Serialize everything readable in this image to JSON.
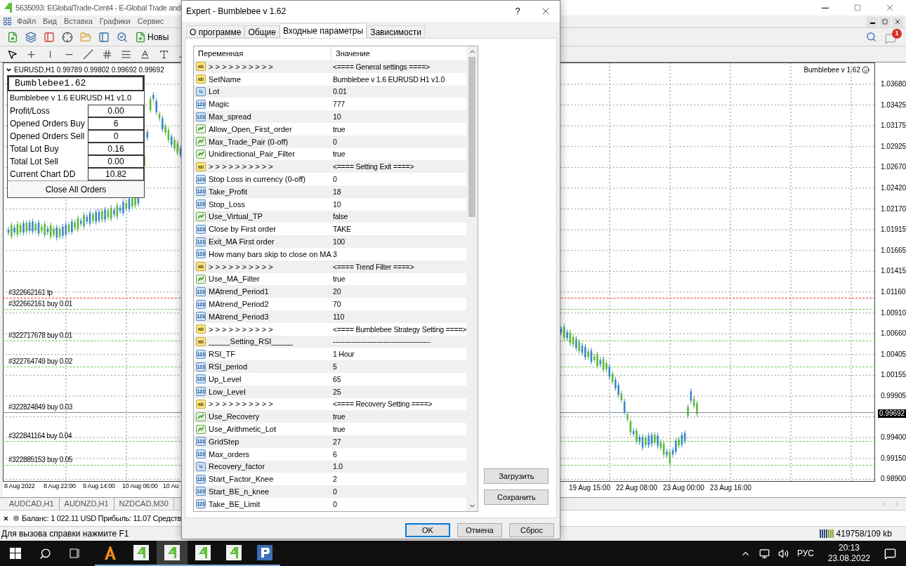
{
  "main_window": {
    "title": "5635093: EGlobalTrade-Cent4 - E-Global Trade and"
  },
  "menu": [
    "Файл",
    "Вид",
    "Вставка",
    "Графики",
    "Сервис"
  ],
  "toolbar": {
    "new_order_label": "Новы"
  },
  "notifications": {
    "count": "1"
  },
  "chart": {
    "symbol": "EURUSD,H1",
    "quotes": "0.99789 0.99802 0.99692 0.99692",
    "expert_label": "Bumblebee v 1.62",
    "order_lines": [
      {
        "label": "#322662161 tp",
        "kind": "tp"
      },
      {
        "label": "#322662161 buy 0.01",
        "kind": "buy"
      },
      {
        "label": "#322717678 buy 0.01",
        "kind": "buy"
      },
      {
        "label": "#322764749 buy 0.02",
        "kind": "buy"
      },
      {
        "label": "#322824849 buy 0.03",
        "kind": "price"
      },
      {
        "label": "#322841164 buy 0.04",
        "kind": "buy"
      },
      {
        "label": "#322885153 buy 0.05",
        "kind": "buy"
      }
    ],
    "price_labels": [
      "1.03680",
      "1.03425",
      "1.03175",
      "1.02925",
      "1.02670",
      "1.02420",
      "1.02170",
      "1.01915",
      "1.01665",
      "1.01415",
      "1.01160",
      "1.00910",
      "1.00660",
      "1.00405",
      "1.00155",
      "0.99905",
      "0.99400",
      "0.99150",
      "0.98900"
    ],
    "current_price": "0.99692",
    "time_labels_left": [
      "8 Aug 2022",
      "8 Aug 22:00",
      "9 Aug 14:00",
      "10 Aug 06:00",
      "10 Au"
    ],
    "time_labels_right": [
      "19 Aug 15:00",
      "22 Aug 08:00",
      "23 Aug 00:00",
      "23 Aug 16:00"
    ]
  },
  "info_panel": {
    "title": "Bumblebee1.62",
    "subtitle": "Bumblebee v 1.6 EURUSD H1 v1.0",
    "rows": [
      {
        "label": "Profit/Loss",
        "value": "0.00"
      },
      {
        "label": "Opened Orders Buy",
        "value": "6"
      },
      {
        "label": "Opened Orders Sell",
        "value": "0"
      },
      {
        "label": "Total Lot Buy",
        "value": "0.16"
      },
      {
        "label": "Total Lot Sell",
        "value": "0.00"
      },
      {
        "label": "Current Chart DD",
        "value": "10.82"
      }
    ],
    "button": "Close All Orders"
  },
  "chart_tabs": [
    {
      "label": "AUDCAD,H1",
      "selected": false
    },
    {
      "label": "AUDNZD,H1",
      "selected": false
    },
    {
      "label": "NZDCAD,M30",
      "selected": false
    }
  ],
  "terminal": {
    "summary": "Баланс: 1 022.11 USD Прибыль: 11.07 Средств"
  },
  "status_bar": {
    "help": "Для вызова справки нажмите F1",
    "traffic": "419758/109 kb"
  },
  "dialog": {
    "title": "Expert - Bumblebee v 1.62",
    "help": "?",
    "tabs": [
      {
        "label": "О программе",
        "selected": false
      },
      {
        "label": "Общие",
        "selected": false
      },
      {
        "label": "Входные параметры",
        "selected": true
      },
      {
        "label": "Зависимости",
        "selected": false
      }
    ],
    "columns": [
      "Переменная",
      "Значение"
    ],
    "rows": [
      {
        "kind": "string",
        "tag": "ab",
        "name": "> > > > > > > > > >",
        "value": "<==== General settings ====>"
      },
      {
        "kind": "string",
        "tag": "ab",
        "name": "SetName",
        "value": "Bumblebee v 1.6 EURUSD H1 v1.0"
      },
      {
        "kind": "double",
        "tag": "½",
        "name": "Lot",
        "value": "0.01"
      },
      {
        "kind": "int",
        "tag": "123",
        "name": "Magic",
        "value": "777"
      },
      {
        "kind": "int",
        "tag": "123",
        "name": "Max_spread",
        "value": "10"
      },
      {
        "kind": "bool",
        "name": "Allow_Open_First_order",
        "value": "true"
      },
      {
        "kind": "bool",
        "name": "Max_Trade_Pair (0-off)",
        "value": "0"
      },
      {
        "kind": "bool",
        "name": "Unidirectional_Pair_Filter",
        "value": "true"
      },
      {
        "kind": "string",
        "tag": "ab",
        "name": "> > > > > > > > > >",
        "value": "<==== Setting Exit ====>"
      },
      {
        "kind": "int",
        "tag": "123",
        "name": "Stop Loss in currency (0-off)",
        "value": "0"
      },
      {
        "kind": "int",
        "tag": "123",
        "name": "Take_Profit",
        "value": "18"
      },
      {
        "kind": "int",
        "tag": "123",
        "name": "Stop_Loss",
        "value": "10"
      },
      {
        "kind": "bool",
        "name": "Use_Virtual_TP",
        "value": "false"
      },
      {
        "kind": "int",
        "tag": "123",
        "name": "Close by First order",
        "value": "TAKE"
      },
      {
        "kind": "int",
        "tag": "123",
        "name": "Exit_MA First order",
        "value": "100"
      },
      {
        "kind": "int",
        "tag": "123",
        "name": "How many bars skip to close on MA",
        "value": "3"
      },
      {
        "kind": "string",
        "tag": "ab",
        "name": "> > > > > > > > > >",
        "value": "<==== Trend Filter ====>"
      },
      {
        "kind": "bool",
        "name": "Use_MA_Filter",
        "value": "true"
      },
      {
        "kind": "int",
        "tag": "123",
        "name": "MAtrend_Period1",
        "value": "20"
      },
      {
        "kind": "int",
        "tag": "123",
        "name": "MAtrend_Period2",
        "value": "70"
      },
      {
        "kind": "int",
        "tag": "123",
        "name": "MAtrend_Period3",
        "value": "110"
      },
      {
        "kind": "string",
        "tag": "ab",
        "name": "> > > > > > > > > >",
        "value": "<==== Bumblebee Strategy Setting ====>"
      },
      {
        "kind": "string",
        "tag": "ab",
        "name": "_____Setting_RSI_____",
        "value": "------------------------------------------"
      },
      {
        "kind": "int",
        "tag": "123",
        "name": "RSI_TF",
        "value": "1 Hour"
      },
      {
        "kind": "int",
        "tag": "123",
        "name": "RSI_period",
        "value": "5"
      },
      {
        "kind": "int",
        "tag": "123",
        "name": "Up_Level",
        "value": "65"
      },
      {
        "kind": "int",
        "tag": "123",
        "name": "Low_Level",
        "value": "25"
      },
      {
        "kind": "string",
        "tag": "ab",
        "name": "> > > > > > > > > >",
        "value": "<==== Recovery Setting ====>"
      },
      {
        "kind": "bool",
        "name": "Use_Recovery",
        "value": "true"
      },
      {
        "kind": "bool",
        "name": "Use_Arithmetic_Lot",
        "value": "true"
      },
      {
        "kind": "int",
        "tag": "123",
        "name": "GridStep",
        "value": "27"
      },
      {
        "kind": "int",
        "tag": "123",
        "name": "Max_orders",
        "value": "6"
      },
      {
        "kind": "double",
        "tag": "½",
        "name": "Recovery_factor",
        "value": "1.0"
      },
      {
        "kind": "int",
        "tag": "123",
        "name": "Start_Factor_Knee",
        "value": "2"
      },
      {
        "kind": "int",
        "tag": "123",
        "name": "Start_BE_n_knee",
        "value": "0"
      },
      {
        "kind": "int",
        "tag": "123",
        "name": "Take_BE_Limit",
        "value": "0"
      }
    ],
    "side_buttons": [
      "Загрузить",
      "Сохранить"
    ],
    "buttons": [
      "OK",
      "Отмена",
      "Сброс"
    ]
  },
  "taskbar": {
    "language": "РУС",
    "time": "20:13",
    "date": "23.08.2022"
  }
}
